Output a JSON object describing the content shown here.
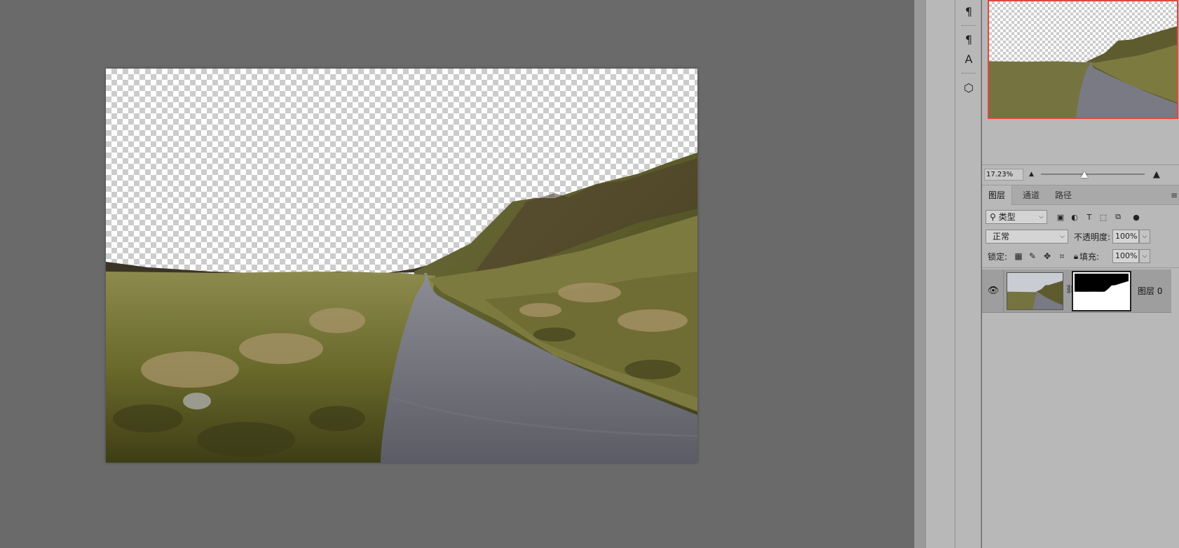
{
  "navigator": {
    "zoom_value": "17.23%",
    "zoom_slider_position": 0.42,
    "zoom_out_icon": "small-mountain-icon",
    "zoom_in_icon": "large-mountain-icon"
  },
  "icon_strip": {
    "items": [
      {
        "name": "paragraph-icon",
        "glyph": "¶"
      },
      {
        "name": "paragraph-styles-icon",
        "glyph": "¶"
      },
      {
        "name": "character-styles-icon",
        "glyph": "A"
      },
      {
        "name": "3d-cube-icon",
        "glyph": "⬡"
      }
    ]
  },
  "layers_panel": {
    "tabs": [
      {
        "label": "图层",
        "active": true
      },
      {
        "label": "通道",
        "active": false
      },
      {
        "label": "路径",
        "active": false
      }
    ],
    "filter": {
      "label": "类型",
      "icon": "search-icon"
    },
    "filter_icons": [
      "image-filter-icon",
      "adjustment-filter-icon",
      "type-filter-icon",
      "shape-filter-icon",
      "smart-object-filter-icon",
      "filter-toggle-icon"
    ],
    "blend_mode": "正常",
    "opacity_label": "不透明度:",
    "opacity_value": "100%",
    "lock_label": "锁定:",
    "lock_icons": [
      "lock-transparent-pixels-icon",
      "lock-image-pixels-icon",
      "lock-position-icon",
      "lock-artboard-icon",
      "lock-all-icon"
    ],
    "fill_label": "填充:",
    "fill_value": "100%",
    "layers": [
      {
        "name": "图层 0",
        "visible": true,
        "has_mask": true,
        "selected": true
      }
    ]
  },
  "colors": {
    "workspace": "#6a6a6a",
    "panel": "#b8b8b8",
    "navigator_frame": "#e0473f",
    "selected_layer": "#9e9e9e"
  }
}
